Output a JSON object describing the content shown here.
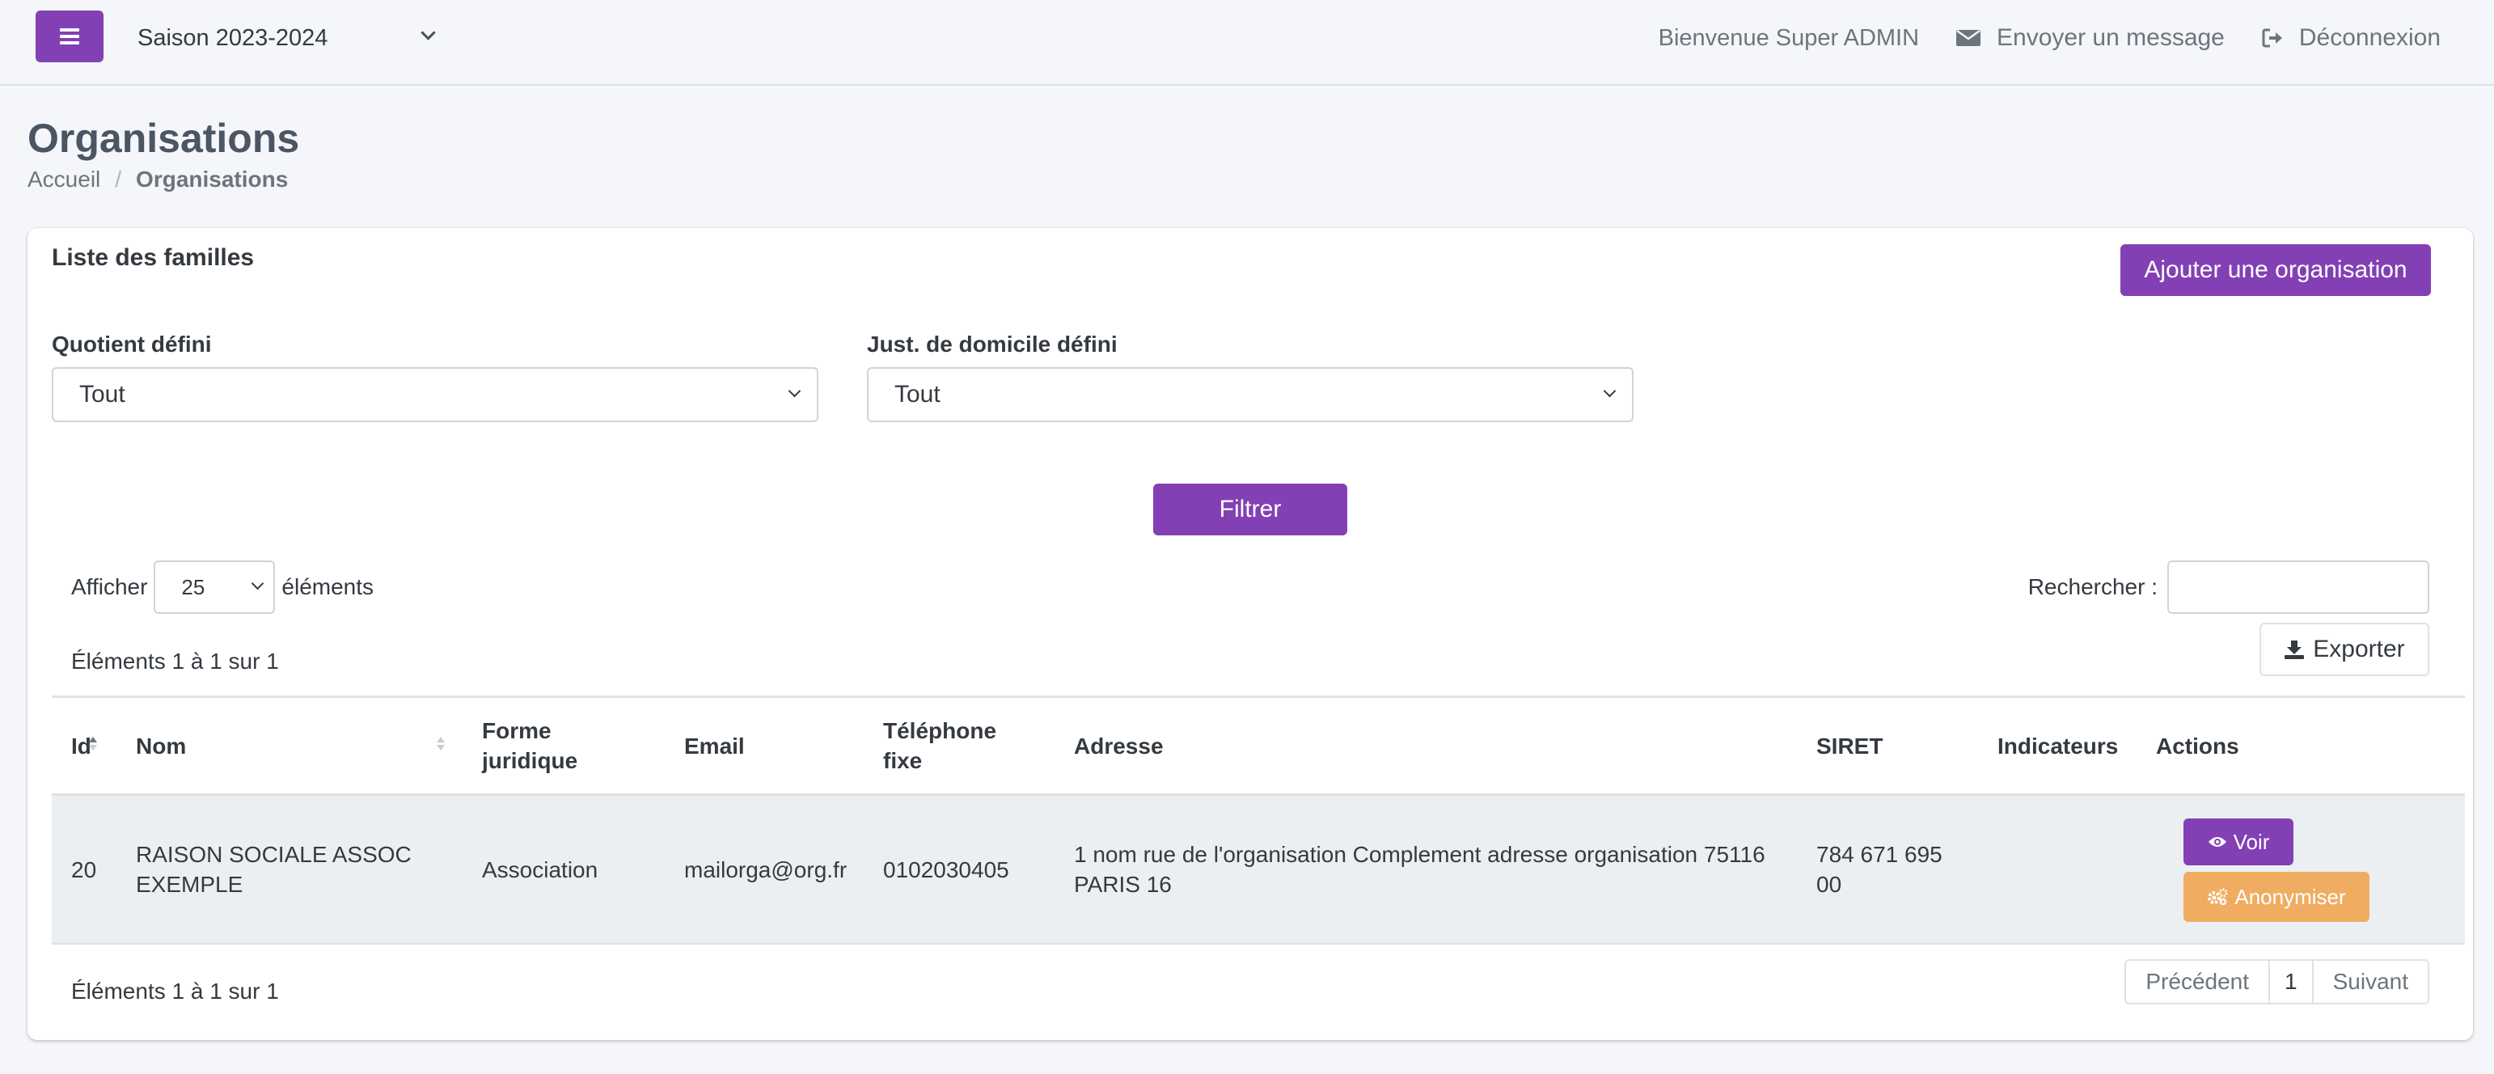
{
  "navbar": {
    "season": "Saison 2023-2024",
    "welcome": "Bienvenue Super ADMIN",
    "message_link": "Envoyer un message",
    "logout_link": "Déconnexion"
  },
  "header": {
    "title": "Organisations",
    "breadcrumb": {
      "home": "Accueil",
      "separator": "/",
      "current": "Organisations"
    }
  },
  "card": {
    "title": "Liste des familles",
    "add_button": "Ajouter une organisation",
    "filters": {
      "quotient": {
        "label": "Quotient défini",
        "value": "Tout"
      },
      "domicile": {
        "label": "Just. de domicile défini",
        "value": "Tout"
      },
      "filter_button": "Filtrer"
    },
    "length": {
      "prefix": "Afficher",
      "value": "25",
      "suffix": "éléments"
    },
    "search_label": "Rechercher :",
    "info": "Éléments 1 à 1 sur 1",
    "export_button": "Exporter"
  },
  "table": {
    "columns": {
      "id": "Id",
      "nom": "Nom",
      "forme_1": "Forme",
      "forme_2": "juridique",
      "email": "Email",
      "tel_1": "Téléphone",
      "tel_2": "fixe",
      "adresse": "Adresse",
      "siret": "SIRET",
      "indicateurs": "Indicateurs",
      "actions": "Actions"
    },
    "rows": [
      {
        "id": "20",
        "nom_1": "RAISON SOCIALE ASSOC",
        "nom_2": "EXEMPLE",
        "forme": "Association",
        "email": "mailorga@org.fr",
        "tel": "0102030405",
        "adresse_1": "1 nom rue de l'organisation Complement adresse organisation 75116",
        "adresse_2": "PARIS 16",
        "siret_1": "784 671 695",
        "siret_2": "00",
        "indicateurs": "",
        "voir": "Voir",
        "anonymiser": "Anonymiser"
      }
    ]
  },
  "pagination": {
    "prev": "Précédent",
    "page": "1",
    "next": "Suivant"
  },
  "colors": {
    "primary": "#8340b5",
    "warning": "#f0ad62",
    "row_bg": "#eceff2"
  },
  "icons": [
    "bars-icon",
    "chevron-down-icon",
    "envelope-icon",
    "sign-out-icon",
    "download-icon",
    "eye-icon",
    "cogs-icon",
    "sort-icon"
  ]
}
